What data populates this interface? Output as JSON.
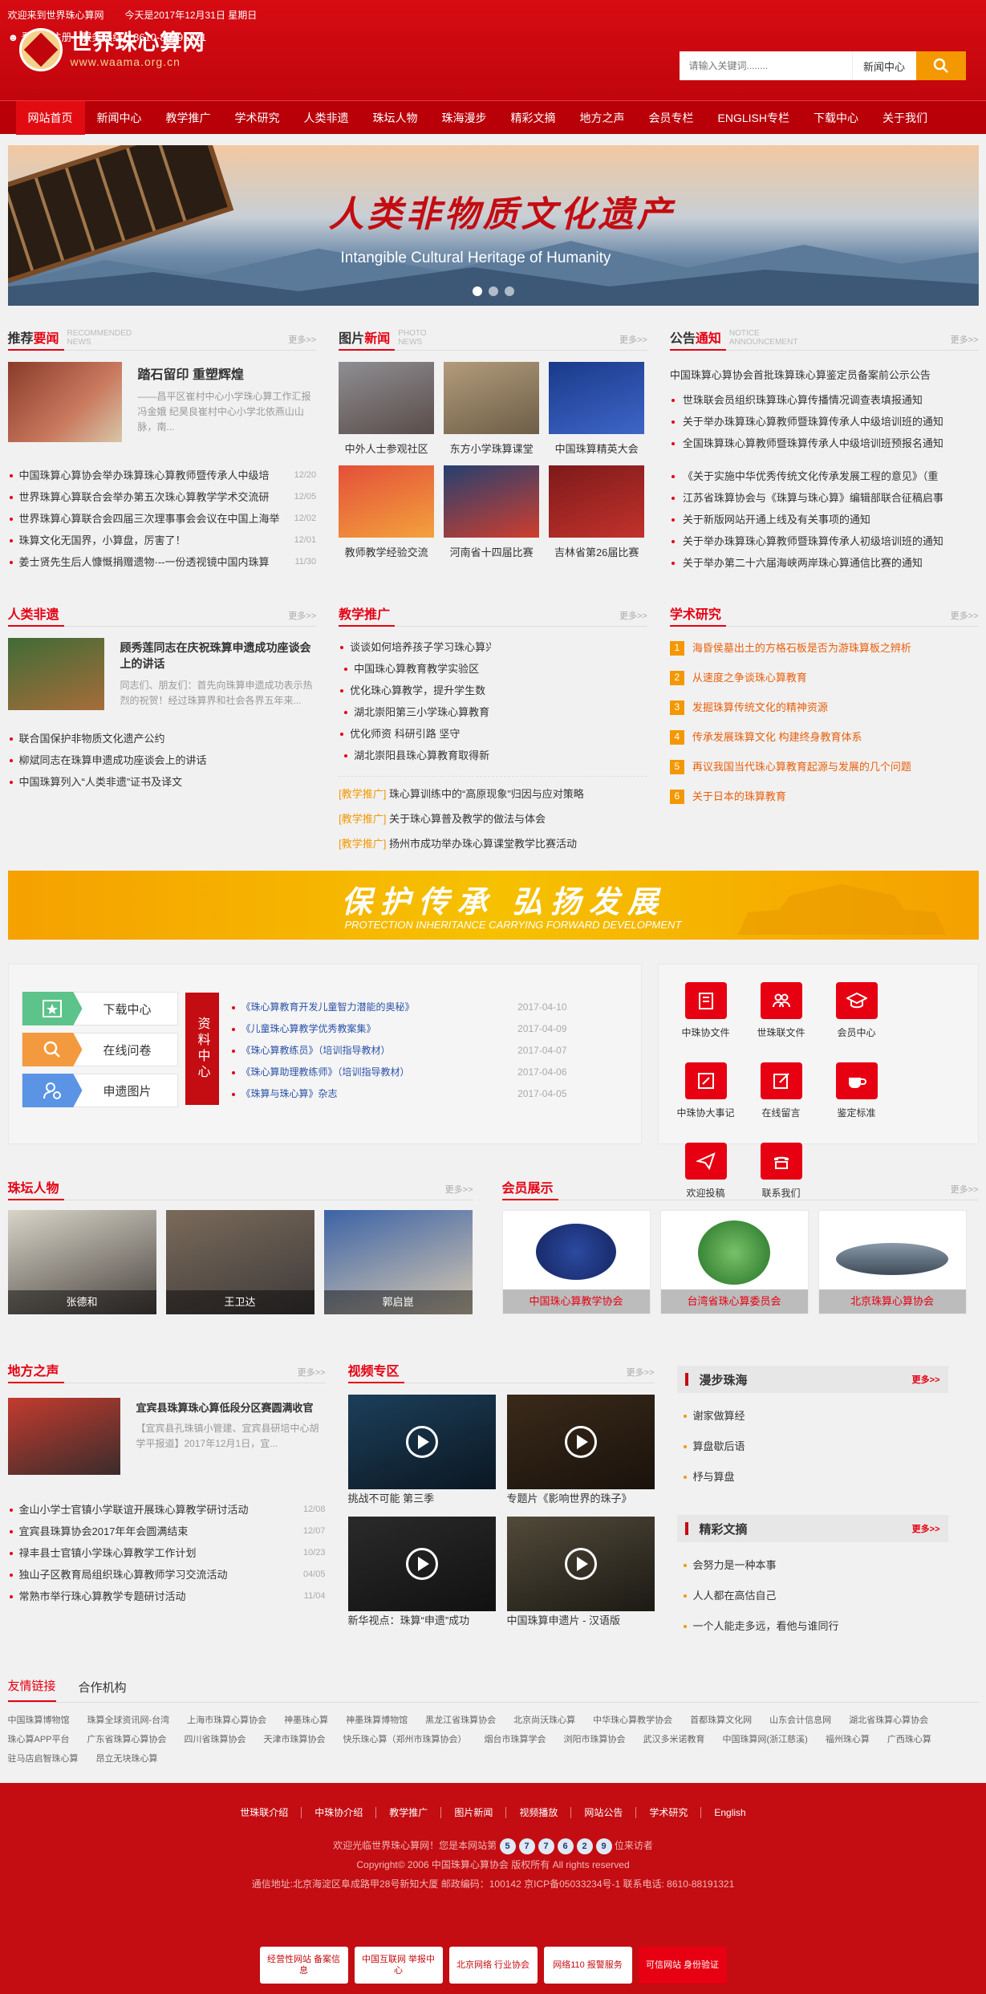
{
  "header": {
    "welcome": "欢迎来到世界珠心算网",
    "date": "今天是2017年12月31日  星期日",
    "login": "登录",
    "sep": "|",
    "register": "注册",
    "hotline": "服务热线：8610-88191321",
    "logo_title": "世界珠心算网",
    "logo_url": "www.waama.org.cn",
    "search_placeholder": "请输入关键词........",
    "search_category": "新闻中心"
  },
  "nav": [
    "网站首页",
    "新闻中心",
    "教学推广",
    "学术研究",
    "人类非遗",
    "珠坛人物",
    "珠海漫步",
    "精彩文摘",
    "地方之声",
    "会员专栏",
    "ENGLISH专栏",
    "下载中心",
    "关于我们"
  ],
  "banner": {
    "title": "人类非物质文化遗产",
    "subtitle": "Intangible Cultural Heritage of Humanity"
  },
  "recommend": {
    "title_a": "推荐",
    "title_b": "要闻",
    "en1": "RECOMMENDED",
    "en2": "NEWS",
    "more": "更多>>",
    "feature_title": "踏石留印 重塑辉煌",
    "feature_desc": "——昌平区崔村中心小学珠心算工作汇报 冯金娥 纪昊良崔村中心小学北依燕山山脉，南...",
    "items": [
      {
        "t": "中国珠算心算协会举办珠算珠心算教师暨传承人中级培",
        "d": "12/20"
      },
      {
        "t": "世界珠算心算联合会举办第五次珠心算教学学术交流研",
        "d": "12/05"
      },
      {
        "t": "世界珠算心算联合会四届三次理事事会会议在中国上海举",
        "d": "12/02"
      },
      {
        "t": "珠算文化无国界，小算盘，厉害了！",
        "d": "12/01"
      },
      {
        "t": "姜士贤先生后人慷慨捐赠遗物·--一份透视镜中国内珠算",
        "d": "11/30"
      }
    ]
  },
  "photonews": {
    "title_a": "图片",
    "title_b": "新闻",
    "en1": "PHOTO",
    "en2": "NEWS",
    "more": "更多>>",
    "items": [
      "中外人士参观社区",
      "东方小学珠算课堂",
      "中国珠算精英大会",
      "教师教学经验交流",
      "河南省十四届比赛",
      "吉林省第26届比赛"
    ]
  },
  "notice": {
    "title_a": "公告",
    "title_b": "通知",
    "en1": "NOTICE",
    "en2": "ANNOUNCEMENT",
    "more": "更多>>",
    "headline": "中国珠算心算协会首批珠算珠心算鉴定员备案前公示公告",
    "items": [
      "世珠联会员组织珠算珠心算传播情况调查表填报通知",
      "关于举办珠算珠心算教师暨珠算传承人中级培训班的通知",
      "全国珠算珠心算教师暨珠算传承人中级培训班预报名通知",
      "《关于实施中华优秀传统文化传承发展工程的意见》（重",
      "江苏省珠算协会与《珠算与珠心算》编辑部联合征稿启事",
      "关于新版网站开通上线及有关事项的通知",
      "关于举办珠算珠心算教师暨珠算传承人初级培训班的通知",
      "关于举办第二十六届海峡两岸珠心算通信比赛的通知"
    ]
  },
  "heritage": {
    "title": "人类非遗",
    "more": "更多>>",
    "feature_title": "顾秀莲同志在庆祝珠算申遗成功座谈会上的讲话",
    "feature_desc": "同志们、朋友们：首先向珠算申遗成功表示热烈的祝贺！经过珠算界和社会各界五年来...",
    "items": [
      "联合国保护非物质文化遗产公约",
      "柳斌同志在珠算申遗成功座谈会上的讲话",
      "中国珠算列入“人类非遗”证书及译文"
    ]
  },
  "teaching": {
    "title": "教学推广",
    "more": "更多>>",
    "grid": [
      "谈谈如何培养孩子学习珠心算兴趣",
      "中国珠心算教育教学实验区",
      "优化珠心算教学，提升学生数",
      "湖北崇阳第三小学珠心算教育",
      "优化师资 科研引路 坚守",
      "湖北崇阳县珠心算教育取得新"
    ],
    "tag": "[教学推广]",
    "tagged": [
      "珠心算训练中的“高原现象”归因与应对策略",
      "关于珠心算普及教学的做法与体会",
      "扬州市成功举办珠心算课堂教学比赛活动"
    ]
  },
  "academic": {
    "title": "学术研究",
    "more": "更多>>",
    "items": [
      "海昏侯墓出土的方格石板是否为游珠算板之辨析",
      "从速度之争谈珠心算教育",
      "发掘珠算传统文化的精神资源",
      "传承发展珠算文化 构建终身教育体系",
      "再议我国当代珠心算教育起源与发展的几个问题",
      "关于日本的珠算教育"
    ]
  },
  "adbanner": {
    "text": "保护传承   弘扬发展",
    "en": "PROTECTION INHERITANCE CARRYING FORWARD DEVELOPMENT"
  },
  "service": {
    "buttons": [
      "下载中心",
      "在线问卷",
      "申遗图片"
    ],
    "center_label": "资料中心",
    "downloads": [
      {
        "t": "《珠心算教育开发儿童智力潜能的奥秘》",
        "d": "2017-04-10"
      },
      {
        "t": "《儿童珠心算教学优秀教案集》",
        "d": "2017-04-09"
      },
      {
        "t": "《珠心算教练员》（培训指导教材）",
        "d": "2017-04-07"
      },
      {
        "t": "《珠心算助理教练师》（培训指导教材）",
        "d": "2017-04-06"
      },
      {
        "t": "《珠算与珠心算》杂志",
        "d": "2017-04-05"
      }
    ],
    "icons": [
      "中珠协文件",
      "世珠联文件",
      "会员中心",
      "中珠协大事记",
      "在线留言",
      "鉴定标准",
      "欢迎投稿",
      "联系我们"
    ]
  },
  "people": {
    "title": "珠坛人物",
    "more": "更多>>",
    "items": [
      "张德和",
      "王卫达",
      "郭启崑"
    ]
  },
  "members": {
    "title": "会员展示",
    "more": "更多>>",
    "items": [
      "中国珠心算教学协会",
      "台湾省珠心算委员会",
      "北京珠算心算协会"
    ]
  },
  "local": {
    "title": "地方之声",
    "more": "更多>>",
    "feature_title": "宜宾县珠算珠心算低段分区赛圆满收官",
    "feature_desc": "【宜宾县孔珠镇小管建、宜宾县研培中心胡学平报道】2017年12月1日，宜...",
    "items": [
      {
        "t": "金山小学士官镇小学联谊开展珠心算教学研讨活动",
        "d": "12/08"
      },
      {
        "t": "宜宾县珠算协会2017年年会圆满结束",
        "d": "12/07"
      },
      {
        "t": "禄丰县士官镇小学珠心算教学工作计划",
        "d": "10/23"
      },
      {
        "t": "独山子区教育局组织珠心算教师学习交流活动",
        "d": "04/05"
      },
      {
        "t": "常熟市举行珠心算教学专题研讨活动",
        "d": "11/04"
      }
    ]
  },
  "video": {
    "title": "视频专区",
    "more": "更多>>",
    "items": [
      "挑战不可能 第三季",
      "专题片《影响世界的珠子》",
      "新华视点：珠算“申遗”成功",
      "中国珠算申遗片 - 汉语版"
    ]
  },
  "sidebar": {
    "stroll": {
      "title": "漫步珠海",
      "more": "更多>>",
      "items": [
        "谢家做算经",
        "算盘歇后语",
        "杼与算盘"
      ]
    },
    "digest": {
      "title": "精彩文摘",
      "more": "更多>>",
      "items": [
        "会努力是一种本事",
        "人人都在高估自己",
        "一个人能走多远，看他与谁同行"
      ]
    }
  },
  "links": {
    "tabs": [
      "友情链接",
      "合作机构"
    ],
    "items": [
      "中国珠算博物馆",
      "珠算全球资讯网-台湾",
      "上海市珠算心算协会",
      "神墨珠心算",
      "神墨珠算博物馆",
      "黑龙江省珠算协会",
      "北京尚沃珠心算",
      "中华珠心算教学协会",
      "首都珠算文化网",
      "山东会计信息网",
      "湖北省珠算心算协会",
      "珠心算APP平台",
      "广东省珠算心算协会",
      "四川省珠算协会",
      "天津市珠算协会",
      "快乐珠心算（郑州市珠算协会）",
      "烟台市珠算学会",
      "浏阳市珠算协会",
      "武汉多米诺教育",
      "中国珠算网(浙江慈溪)",
      "福州珠心算",
      "广西珠心算",
      "驻马店启智珠心算",
      "昂立无块珠心算"
    ]
  },
  "footer": {
    "nav": [
      "世珠联介绍",
      "中珠协介绍",
      "教学推广",
      "图片新闻",
      "视频播放",
      "网站公告",
      "学术研究",
      "English"
    ],
    "visit_pre": "欢迎光临世界珠心算网！您是本网站第",
    "visit_digits": [
      "5",
      "7",
      "7",
      "6",
      "2",
      "9"
    ],
    "visit_post": "位来访者",
    "copyright": "Copyright© 2006 中国珠算心算协会 版权所有 All rights reserved",
    "address": "通信地址:北京海淀区阜成路甲28号新知大厦 邮政编码：100142 京ICP备05033234号-1 联系电话: 8610-88191321",
    "badges": [
      "经营性网站 备案信息",
      "中国互联网 举报中心",
      "北京网络 行业协会",
      "网络110 报警服务",
      "可信网站 身份验证"
    ]
  }
}
